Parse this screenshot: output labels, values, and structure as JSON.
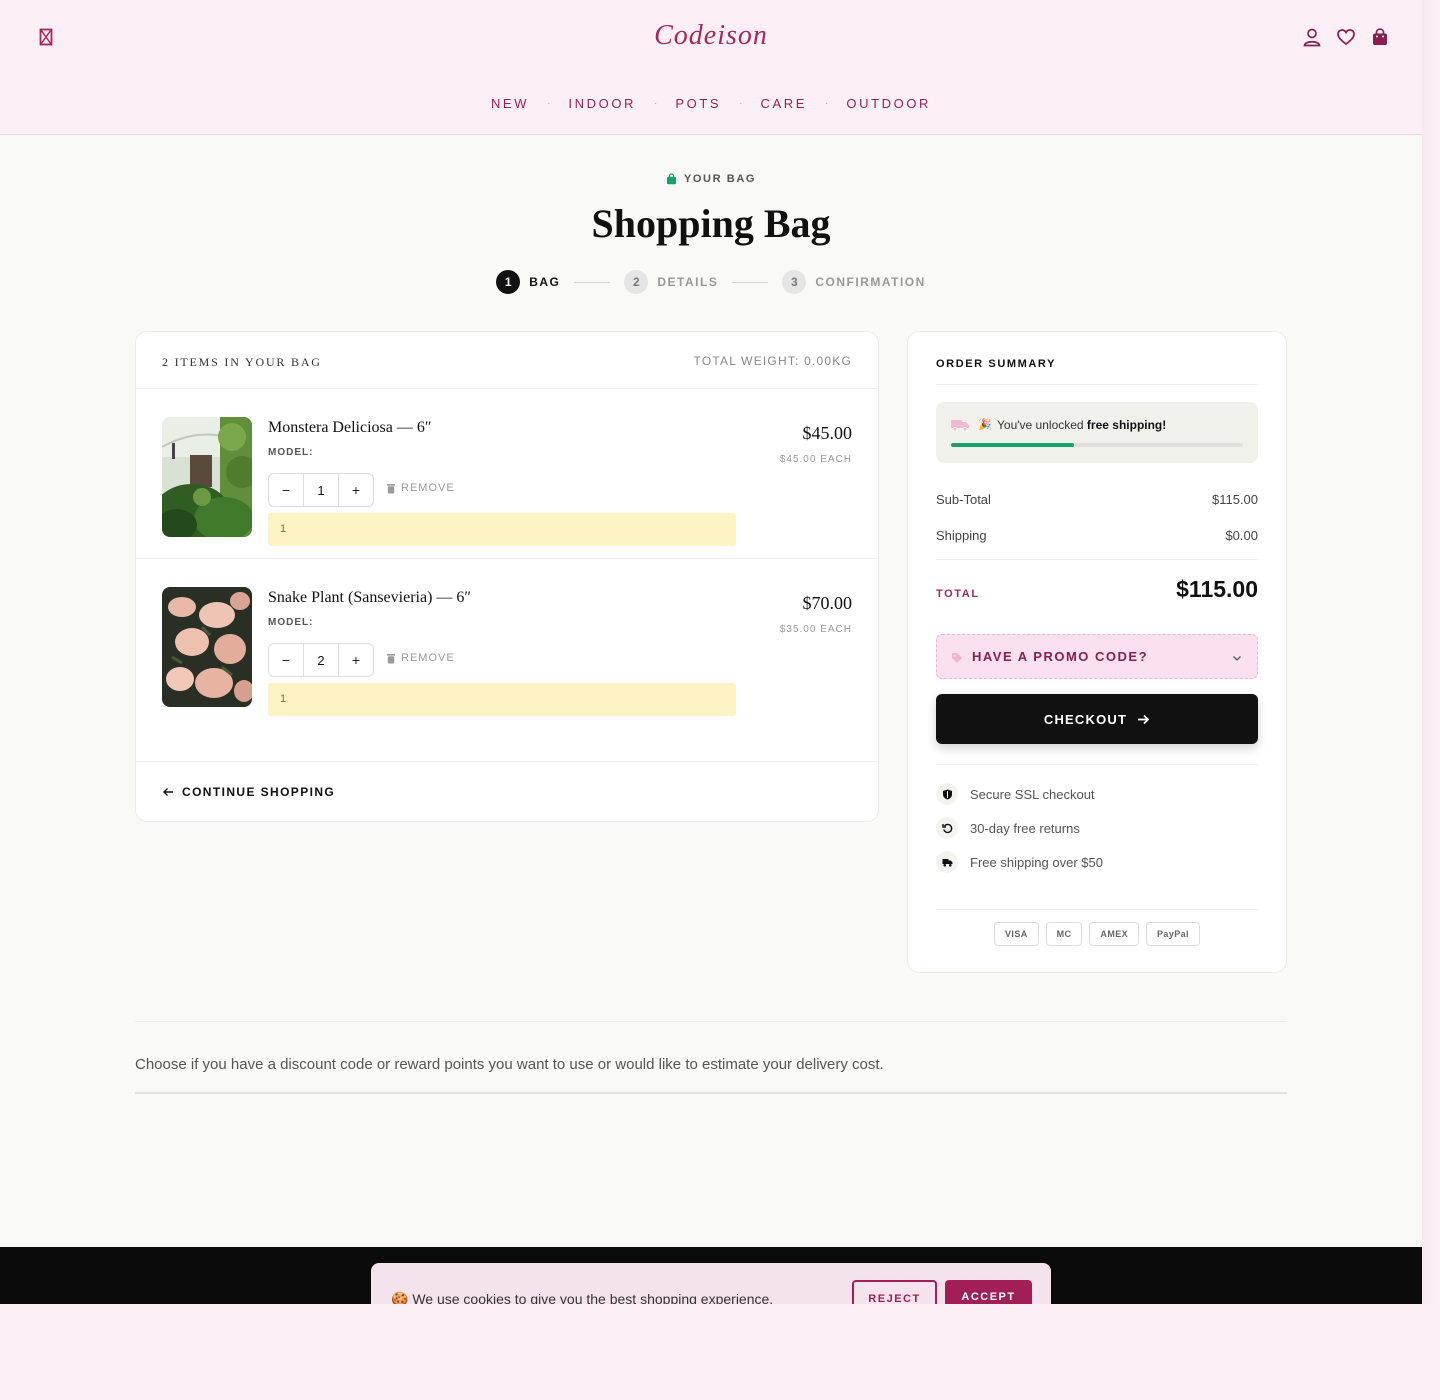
{
  "brand": {
    "logo": "Codeison",
    "accent": "#a8275a"
  },
  "nav": {
    "items": [
      "NEW",
      "INDOOR",
      "POTS",
      "CARE",
      "OUTDOOR"
    ],
    "separator": "·"
  },
  "header_icons": [
    "menu-icon",
    "user-icon",
    "heart-icon",
    "bag-icon"
  ],
  "page": {
    "eyebrow": "YOUR BAG",
    "title": "Shopping Bag"
  },
  "steps": [
    {
      "num": "1",
      "label": "BAG",
      "state": "active"
    },
    {
      "num": "2",
      "label": "DETAILS",
      "state": "todo"
    },
    {
      "num": "3",
      "label": "CONFIRMATION",
      "state": "todo"
    }
  ],
  "cart": {
    "count_label": "2 ITEMS IN YOUR BAG",
    "weight_label": "TOTAL WEIGHT: 0.00KG",
    "items": [
      {
        "name": "Monstera Deliciosa — 6″",
        "model_label": "MODEL:",
        "qty": "1",
        "minus": "−",
        "plus": "+",
        "remove": "REMOVE",
        "note": "1",
        "price": "$45.00",
        "each": "$45.00 EACH"
      },
      {
        "name": "Snake Plant (Sansevieria) — 6″",
        "model_label": "MODEL:",
        "qty": "2",
        "minus": "−",
        "plus": "+",
        "remove": "REMOVE",
        "note": "1",
        "price": "$70.00",
        "each": "$35.00 EACH"
      }
    ],
    "continue": "CONTINUE SHOPPING"
  },
  "summary": {
    "title": "ORDER SUMMARY",
    "shipping_msg_pre": "You've unlocked ",
    "shipping_msg_bold": "free shipping!",
    "shipping_progress": 0.42,
    "subtotal_label": "Sub-Total",
    "subtotal": "$115.00",
    "shipping_label": "Shipping",
    "shipping": "$0.00",
    "total_label": "TOTAL",
    "total": "$115.00",
    "promo": "HAVE A PROMO CODE?",
    "checkout": "CHECKOUT",
    "trust": [
      "Secure SSL checkout",
      "30-day free returns",
      "Free shipping over $50"
    ],
    "payments": [
      "VISA",
      "MC",
      "AMEX",
      "PayPal"
    ]
  },
  "discount_text": "Choose if you have a discount code or reward points you want to use or would like to estimate your delivery cost.",
  "cookie": {
    "text": "We use cookies to give you the best shopping experience.",
    "reject": "REJECT",
    "accept": "ACCEPT"
  }
}
